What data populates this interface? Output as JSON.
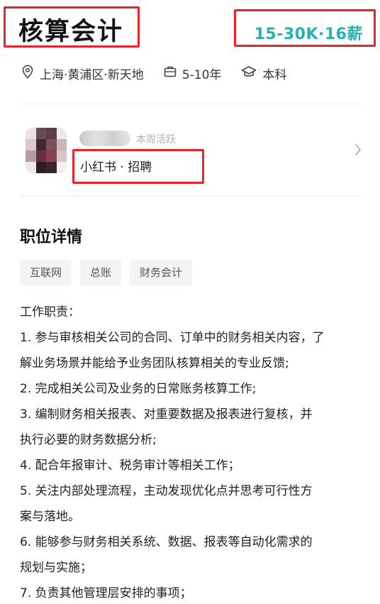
{
  "job": {
    "title": "核算会计",
    "salary": "15-30K·16薪"
  },
  "meta": {
    "location": "上海·黄浦区·新天地",
    "experience": "5-10年",
    "education": "本科",
    "location_icon": "location-pin-icon",
    "experience_icon": "briefcase-icon",
    "education_icon": "graduation-cap-icon"
  },
  "recruiter": {
    "active_status": "本周活跃",
    "company": "小红书 · 招聘"
  },
  "details": {
    "section_title": "职位详情",
    "tags": [
      "互联网",
      "总账",
      "财务会计"
    ],
    "lines": [
      "工作职责：",
      "1. 参与审核相关公司的合同、订单中的财务相关内容，了",
      "解业务场景并能给予业务团队核算相关的专业反馈;",
      "2. 完成相关公司及业务的日常账务核算工作;",
      "3. 编制财务相关报表、对重要数据及报表进行复核，并",
      "执行必要的财务数据分析;",
      "4. 配合年报审计、税务审计等相关工作；",
      "5. 关注内部处理流程，主动发现优化点并思考可行性方",
      "案与落地。",
      "6. 能够参与财务相关系统、数据、报表等自动化需求的",
      "规划与实施；",
      "7. 负责其他管理层安排的事项；"
    ]
  },
  "colors": {
    "salary": "#27b0b6",
    "highlight_border": "#e8242a"
  }
}
